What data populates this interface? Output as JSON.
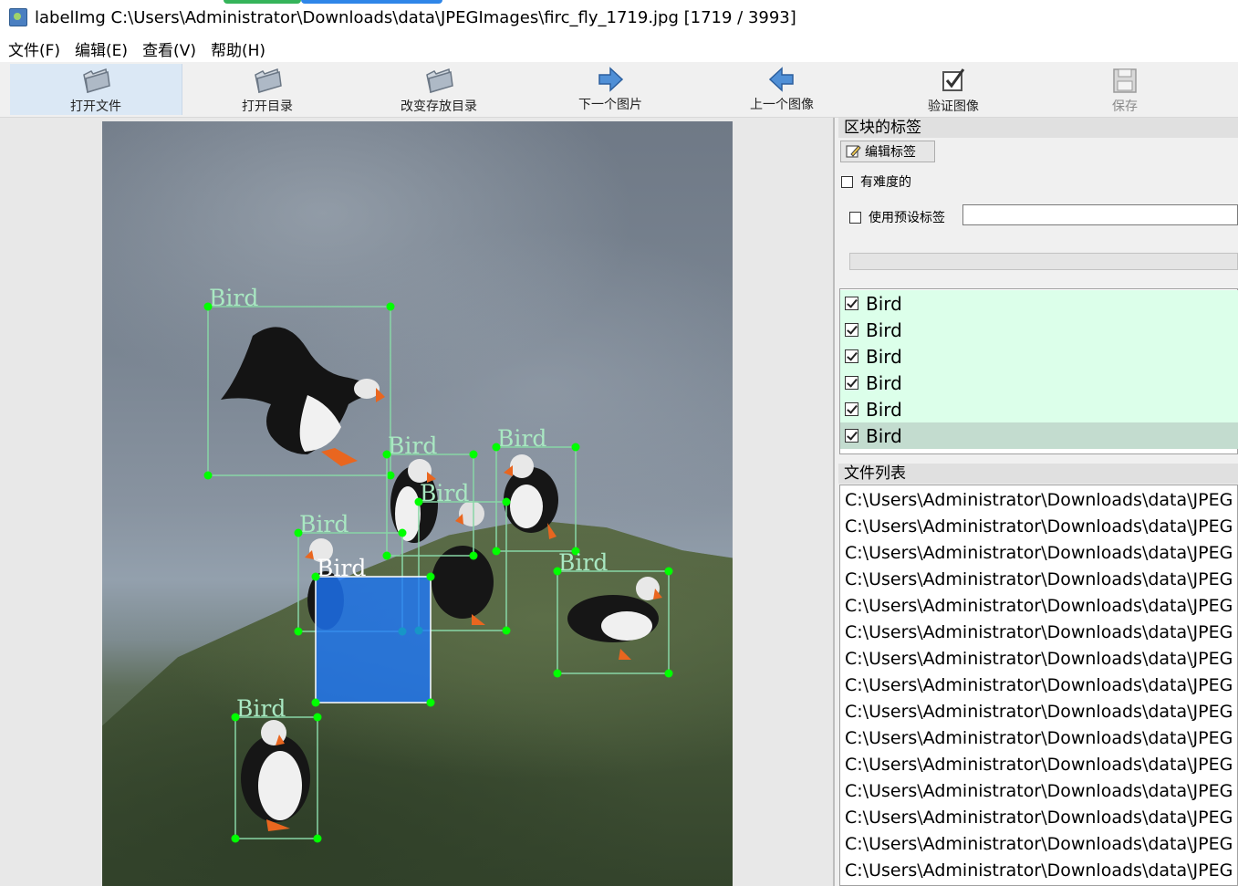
{
  "window": {
    "title": "labelImg C:\\Users\\Administrator\\Downloads\\data\\JPEGImages\\firc_fly_1719.jpg [1719 / 3993]"
  },
  "menu": [
    "文件(F)",
    "编辑(E)",
    "查看(V)",
    "帮助(H)"
  ],
  "toolbar": {
    "open_file": "打开文件",
    "open_dir": "打开目录",
    "change_save_dir": "改变存放目录",
    "next_image": "下一个图片",
    "prev_image": "上一个图像",
    "verify_image": "验证图像",
    "save": "保存"
  },
  "colors": {
    "box_outline": "#88d6a6",
    "vertex": "#00ff00",
    "selected_fill": "#1e78ff",
    "label_text": "#a9e8c2"
  },
  "annotations": {
    "label": "Bird",
    "count": 7
  },
  "dock": {
    "box_labels_title": "区块的标签",
    "edit_label_button": "编辑标签",
    "difficult_checkbox": "有难度的",
    "use_preset_checkbox": "使用预设标签",
    "preset_value": "",
    "labels": [
      {
        "text": "Bird",
        "checked": true,
        "selected": false
      },
      {
        "text": "Bird",
        "checked": true,
        "selected": false
      },
      {
        "text": "Bird",
        "checked": true,
        "selected": false
      },
      {
        "text": "Bird",
        "checked": true,
        "selected": false
      },
      {
        "text": "Bird",
        "checked": true,
        "selected": false
      },
      {
        "text": "Bird",
        "checked": true,
        "selected": true
      }
    ],
    "file_list_title": "文件列表",
    "files": [
      "C:\\Users\\Administrator\\Downloads\\data\\JPEG",
      "C:\\Users\\Administrator\\Downloads\\data\\JPEG",
      "C:\\Users\\Administrator\\Downloads\\data\\JPEG",
      "C:\\Users\\Administrator\\Downloads\\data\\JPEG",
      "C:\\Users\\Administrator\\Downloads\\data\\JPEG",
      "C:\\Users\\Administrator\\Downloads\\data\\JPEG",
      "C:\\Users\\Administrator\\Downloads\\data\\JPEG",
      "C:\\Users\\Administrator\\Downloads\\data\\JPEG",
      "C:\\Users\\Administrator\\Downloads\\data\\JPEG",
      "C:\\Users\\Administrator\\Downloads\\data\\JPEG",
      "C:\\Users\\Administrator\\Downloads\\data\\JPEG",
      "C:\\Users\\Administrator\\Downloads\\data\\JPEG",
      "C:\\Users\\Administrator\\Downloads\\data\\JPEG",
      "C:\\Users\\Administrator\\Downloads\\data\\JPEG",
      "C:\\Users\\Administrator\\Downloads\\data\\JPEG"
    ]
  }
}
